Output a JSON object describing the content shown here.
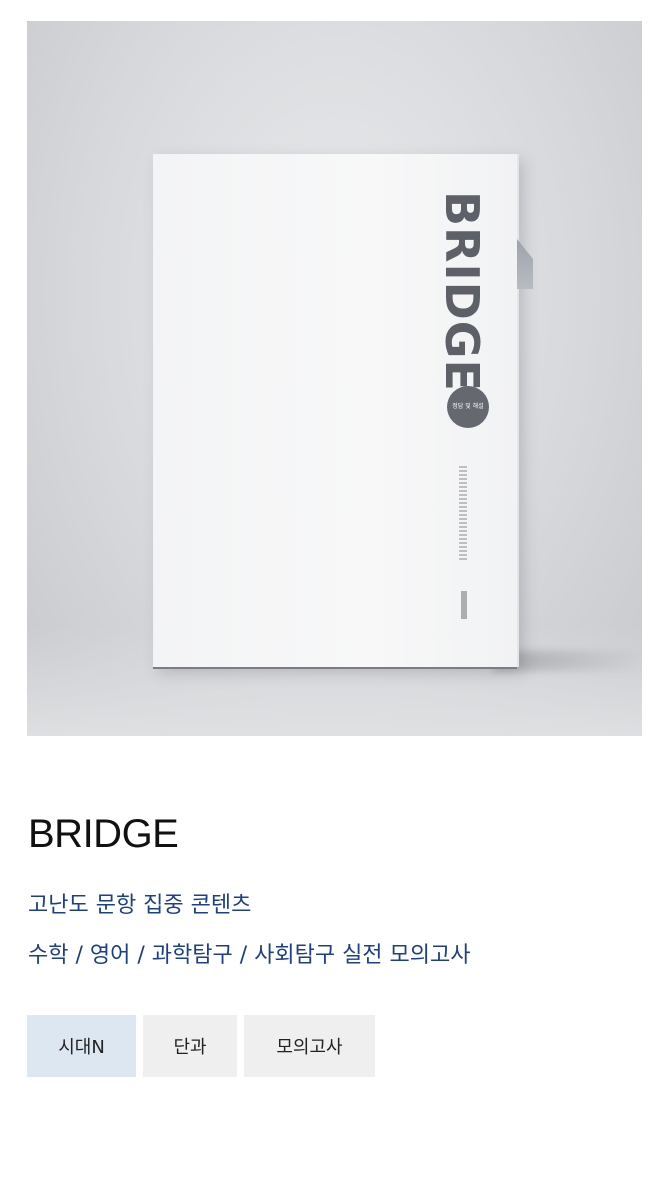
{
  "hero": {
    "book_title": "BRIDGE",
    "badge_text": "정답 및 해설"
  },
  "product": {
    "title": "BRIDGE",
    "description_lines": [
      "고난도 문항 집중 콘텐츠",
      "수학 / 영어 / 과학탐구 / 사회탐구 실전 모의고사"
    ]
  },
  "tags": [
    {
      "label": "시대N",
      "selected": true
    },
    {
      "label": "단과",
      "selected": false
    },
    {
      "label": "모의고사",
      "selected": false
    }
  ],
  "colors": {
    "description": "#1c3f8a",
    "selected_tag_bg": "#dde7f1",
    "tag_bg": "#efefef"
  }
}
